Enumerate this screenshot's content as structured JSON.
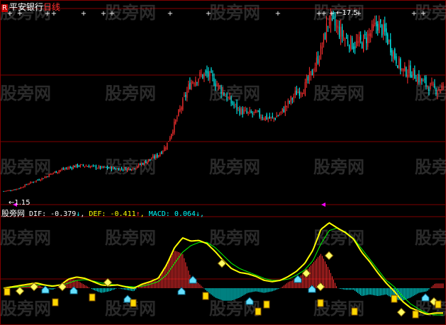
{
  "header": {
    "badge": "R",
    "stock_name": "平安银行",
    "period": "日线"
  },
  "indicator_header": {
    "name": "股旁网",
    "dif_label": "DIF:",
    "dif_value": "-0.379",
    "dif_arrow": "↓",
    "def_label": "DEF:",
    "def_value": "-0.411",
    "def_arrow": "↑",
    "macd_label": "MACD:",
    "macd_value": "0.064",
    "macd_arrow": "↓",
    "trailing": ","
  },
  "watermark": "股旁网",
  "colors": {
    "up": "#ff3030",
    "down": "#00ffff",
    "dif_line": "#ffff00",
    "def_line": "#00ff00",
    "grid": "#800000",
    "marker": "#ff00ff"
  },
  "chart_data": {
    "type": "line",
    "price_labels": {
      "high": "17.5",
      "low": "1.15"
    },
    "price_series": [
      1.2,
      1.3,
      1.5,
      1.9,
      2.2,
      2.5,
      2.9,
      3.2,
      3.4,
      3.6,
      3.6,
      3.5,
      3.4,
      3.4,
      3.3,
      3.3,
      3.4,
      3.8,
      4.2,
      4.6,
      5.5,
      7.5,
      9.5,
      11.5,
      12.0,
      12.2,
      11.5,
      10.5,
      9.5,
      8.8,
      8.5,
      8.5,
      8.2,
      8.0,
      8.5,
      9.5,
      10.5,
      11.0,
      12.5,
      14.5,
      17.5,
      16.5,
      15.5,
      15.0,
      15.2,
      16.0,
      17.0,
      15.8,
      14.0,
      12.5,
      12.5,
      11.8,
      11.2,
      10.8,
      11.0
    ],
    "dif_series": [
      0,
      0.02,
      0.04,
      0.06,
      0.08,
      0.05,
      0.03,
      0.05,
      0.14,
      0.17,
      0.15,
      0.1,
      0.05,
      0.04,
      0.05,
      0.02,
      0,
      0.06,
      0.1,
      0.15,
      0.35,
      0.62,
      0.77,
      0.72,
      0.73,
      0.68,
      0.56,
      0.42,
      0.3,
      0.24,
      0.22,
      0.18,
      0.12,
      0.1,
      0.12,
      0.18,
      0.26,
      0.38,
      0.58,
      0.9,
      1.0,
      0.92,
      0.85,
      0.75,
      0.55,
      0.4,
      0.23,
      0.08,
      -0.05,
      -0.2,
      -0.3,
      -0.35,
      -0.4,
      -0.38,
      -0.38
    ],
    "def_series": [
      0,
      0.01,
      0.02,
      0.03,
      0.05,
      0.05,
      0.04,
      0.04,
      0.08,
      0.12,
      0.13,
      0.11,
      0.08,
      0.06,
      0.05,
      0.03,
      0.02,
      0.03,
      0.06,
      0.1,
      0.2,
      0.38,
      0.55,
      0.65,
      0.7,
      0.7,
      0.62,
      0.5,
      0.38,
      0.3,
      0.25,
      0.2,
      0.15,
      0.12,
      0.12,
      0.14,
      0.2,
      0.28,
      0.42,
      0.68,
      0.88,
      0.92,
      0.86,
      0.76,
      0.6,
      0.44,
      0.28,
      0.12,
      0.02,
      -0.12,
      -0.24,
      -0.32,
      -0.38,
      -0.41,
      -0.41
    ],
    "dif_range": [
      -0.5,
      1.05
    ],
    "price_range": [
      0,
      18
    ]
  }
}
